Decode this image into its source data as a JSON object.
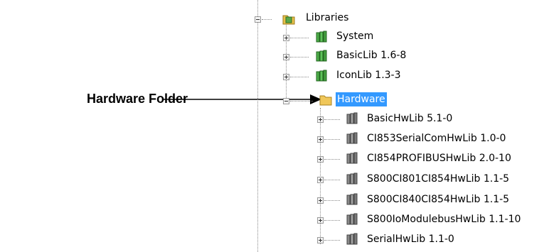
{
  "callout": {
    "text": "Hardware Folder"
  },
  "tree": {
    "root": {
      "label": "Libraries",
      "icon": "folder-library-icon"
    },
    "items": [
      {
        "label": "System",
        "icon": "green-library-icon"
      },
      {
        "label": "BasicLib 1.6-8",
        "icon": "green-library-icon"
      },
      {
        "label": "IconLib 1.3-3",
        "icon": "green-library-icon"
      },
      {
        "label": "Hardware",
        "icon": "folder-icon",
        "selected": true
      }
    ],
    "hardware_items": [
      {
        "label": "BasicHwLib 5.1-0",
        "icon": "gray-library-icon"
      },
      {
        "label": "CI853SerialComHwLib 1.0-0",
        "icon": "gray-library-icon"
      },
      {
        "label": "CI854PROFIBUSHwLib 2.0-10",
        "icon": "gray-library-icon"
      },
      {
        "label": "S800CI801CI854HwLib 1.1-5",
        "icon": "gray-library-icon"
      },
      {
        "label": "S800CI840CI854HwLib 1.1-5",
        "icon": "gray-library-icon"
      },
      {
        "label": "S800IoModulebusHwLib 1.1-10",
        "icon": "gray-library-icon"
      },
      {
        "label": "SerialHwLib 1.1-0",
        "icon": "gray-library-icon"
      }
    ]
  }
}
